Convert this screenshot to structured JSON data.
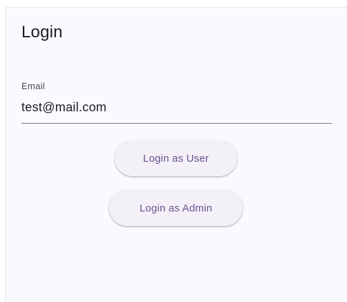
{
  "page": {
    "title": "Login"
  },
  "email_field": {
    "label": "Email",
    "value": "test@mail.com"
  },
  "actions": {
    "login_user_label": "Login as User",
    "login_admin_label": "Login as Admin"
  },
  "colors": {
    "surface": "#fbf8fe",
    "button_bg": "#f4f0f8",
    "button_text": "#65558f",
    "underline": "#79747e",
    "text": "#1d1b20"
  }
}
